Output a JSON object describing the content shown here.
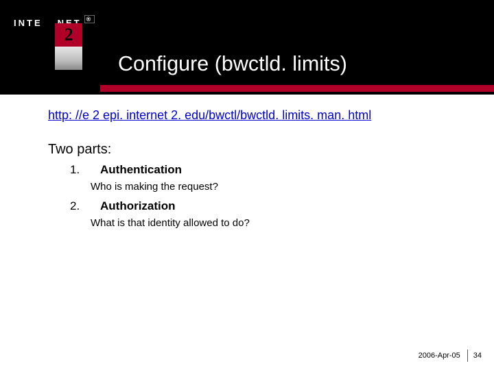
{
  "header": {
    "logo_text_left": "INTE",
    "logo_text_right": "NET",
    "logo_big_digit": "2",
    "reg_mark": "®",
    "title": "Configure (bwctld. limits)"
  },
  "body": {
    "link_text": "http: //e 2 epi. internet 2. edu/bwctl/bwctld. limits. man. html",
    "intro": "Two parts:",
    "items": [
      {
        "num": "1.",
        "title": "Authentication",
        "sub": "Who is making the request?"
      },
      {
        "num": "2.",
        "title": "Authorization",
        "sub": "What is that identity allowed to do?"
      }
    ]
  },
  "footer": {
    "date": "2006-Apr-05",
    "page": "34"
  }
}
